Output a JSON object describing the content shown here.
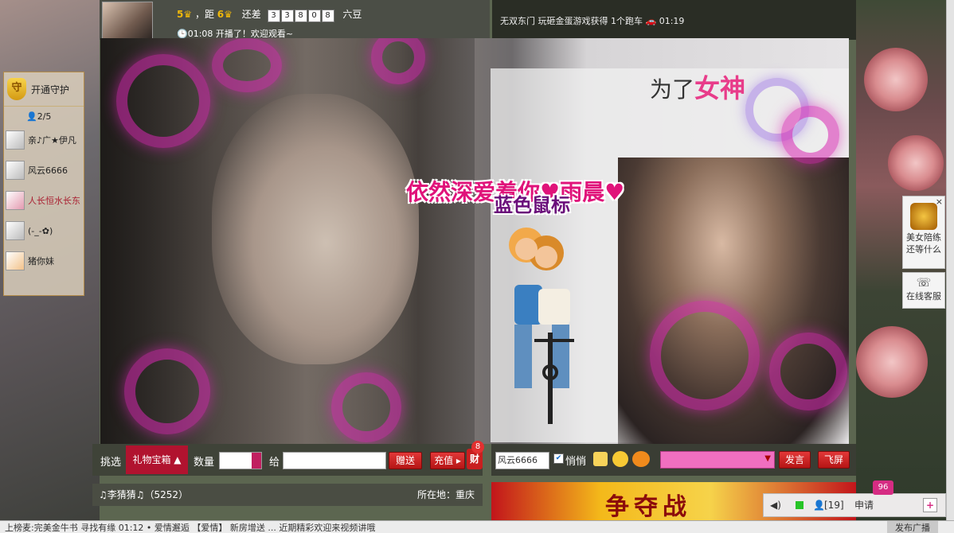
{
  "anchor": {
    "level_label": "5",
    "distance_label": "，距",
    "next_level": "6",
    "remaining_label": "还差",
    "digits": [
      "3",
      "3",
      "8",
      "0",
      "8"
    ],
    "unit": "六豆",
    "broadcast_time": "01:08",
    "broadcast_text": "开播了！欢迎观看~"
  },
  "ticker": {
    "line1_text": "无双东门 玩砸金蛋游戏获得 1个跑车",
    "line1_time": "01:19"
  },
  "guard": {
    "open_label": "开通守护",
    "count": "2/5",
    "members": [
      {
        "name": "亲♪广★伊凡"
      },
      {
        "name": "风云6666"
      },
      {
        "name": "人长恒水长东"
      },
      {
        "name": "(-_-✿)"
      },
      {
        "name": "猪你妹"
      }
    ]
  },
  "video": {
    "title_prefix": "为了",
    "title_highlight": "女神",
    "love_text": "依然深爱着你♥雨晨♥",
    "overlay_text": "蓝色鼠标"
  },
  "gift_bar": {
    "pick_label": "挑选",
    "gift_box_label": "礼物宝箱",
    "quantity_label": "数量",
    "to_label": "给",
    "send_label": "赠送",
    "recharge_label": "充值",
    "wealth_icon": "财",
    "wealth_badge": "8"
  },
  "chat_bar": {
    "target_value": "风云6666",
    "whisper_label": "悄悄",
    "speak_label": "发言",
    "fly_label": "飞屏"
  },
  "info_bar": {
    "name": "♫李猜猜♫",
    "id": "（5252）",
    "location_label": "所在地：重庆"
  },
  "banner": {
    "text": "争夺战"
  },
  "side": {
    "companion_label": "美女陪练还等什么",
    "service_label": "在线客服"
  },
  "status_bar": {
    "badge": "96",
    "count": "[19]",
    "apply_label": "申请"
  },
  "taskbar": {
    "text": "上榜麦:完美金牛书 寻找有缘 01:12 • 爱情邂逅 【爱情】 新房增送 ... 近期精彩欢迎来视频讲哦",
    "right_label": "发布广播"
  }
}
